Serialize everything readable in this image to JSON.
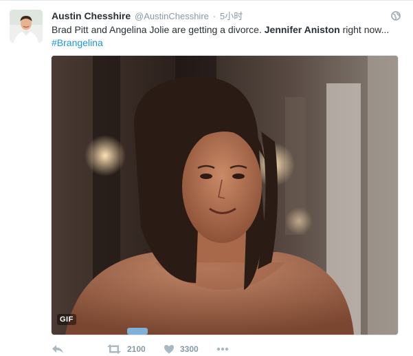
{
  "tweet": {
    "author": {
      "name": "Austin Chesshire",
      "handle": "@AustinChesshire",
      "separator": "·",
      "time": "5小时"
    },
    "text": {
      "part1": "Brad Pitt and Angelina Jolie are getting a divorce. ",
      "bold": "Jennifer Aniston",
      "part2": " right now...",
      "hashtag": "#Brangelina"
    },
    "media": {
      "badge": "GIF"
    },
    "actions": {
      "retweets": "2100",
      "likes": "3300"
    }
  },
  "icons": {
    "globe": "globe-icon",
    "reply": "reply-icon",
    "retweet": "retweet-icon",
    "like": "heart-icon",
    "more": "more-icon"
  },
  "colors": {
    "text": "#292f33",
    "muted": "#8899a6",
    "link": "#1b95e0"
  }
}
